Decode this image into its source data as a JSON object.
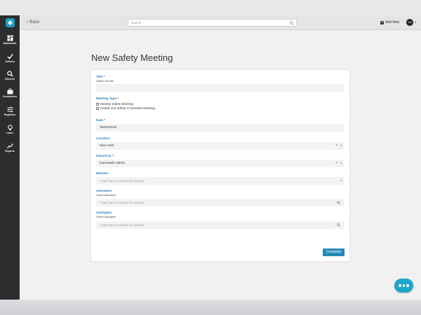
{
  "nav": {
    "items": [
      {
        "label": "Dashboard",
        "icon": "dashboard-icon"
      },
      {
        "label": "Actions",
        "icon": "check-icon"
      },
      {
        "label": "Observe",
        "icon": "search-icon"
      },
      {
        "label": "Contractors",
        "icon": "briefcase-icon"
      },
      {
        "label": "Registers",
        "icon": "sliders-icon"
      },
      {
        "label": "Learn",
        "icon": "lightbulb-icon"
      },
      {
        "label": "Reports",
        "icon": "trend-icon"
      }
    ]
  },
  "topbar": {
    "back_label": "Back",
    "search_placeholder": "Search",
    "add_new_label": "Add New",
    "avatar_initials": "DA"
  },
  "page": {
    "title": "New Safety Meeting"
  },
  "form": {
    "title_label": "Title",
    "title_sublabel": "Safety Tab title",
    "meeting_type_label": "Meeting Type",
    "meeting_type_options": [
      "Weekly Safety Meeting",
      "Health and Safety Committee Meeting"
    ],
    "date_label": "Date",
    "date_value": "30/04/2018",
    "location_label": "Location",
    "location_value": "New York",
    "raised_by_label": "Raised by",
    "raised_by_value": "DoneSafe Admin",
    "minutes_label": "Minutes",
    "minutes_placeholder": "Type here to search for people",
    "attendees_label": "Attendees",
    "attendees_sublabel": "Select Attendees",
    "attendees_placeholder": "Type here to search for people",
    "apologies_label": "Apologies",
    "apologies_sublabel": "Select Apologies",
    "apologies_placeholder": "Type here to search for people",
    "required_marker": "*",
    "clear_glyph": "×",
    "dropdown_glyph": "▾",
    "complete_label": "Complete"
  },
  "colors": {
    "accent": "#2589b9",
    "label_blue": "#2f7eb8",
    "sidebar": "#2c2d2f",
    "chat_fab": "#1da6c9"
  }
}
